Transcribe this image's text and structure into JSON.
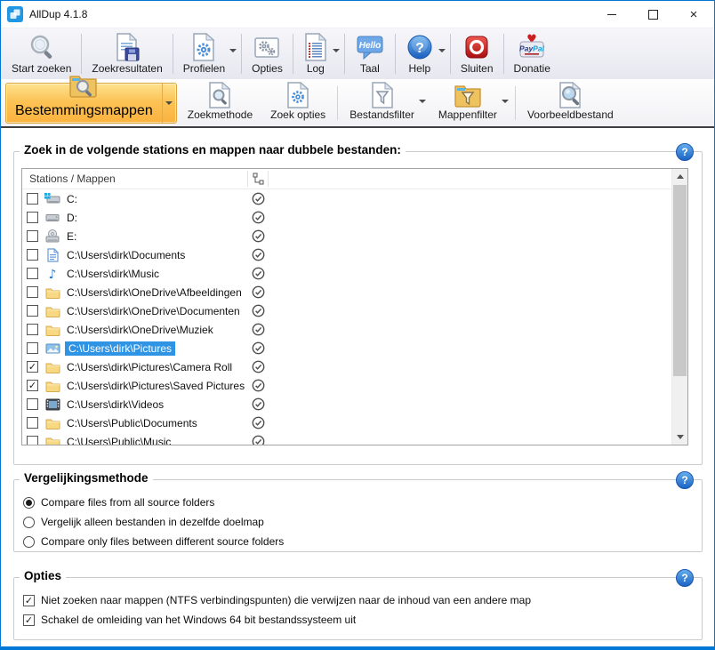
{
  "titlebar": {
    "title": "AllDup 4.1.8"
  },
  "window_controls": {
    "minimize": "minimize",
    "maximize": "maximize",
    "close": "close"
  },
  "toolbar_main": {
    "buttons": [
      {
        "label": "Start zoeken",
        "icon": "search-icon",
        "dropdown": false
      },
      {
        "label": "Zoekresultaten",
        "icon": "search-results-icon",
        "dropdown": false
      },
      {
        "label": "Profielen",
        "icon": "profiles-icon",
        "dropdown": true
      },
      {
        "label": "Opties",
        "icon": "options-icon",
        "dropdown": false
      },
      {
        "label": "Log",
        "icon": "log-icon",
        "dropdown": true
      },
      {
        "label": "Taal",
        "icon": "language-icon",
        "dropdown": false
      },
      {
        "label": "Help",
        "icon": "help-icon",
        "dropdown": true
      },
      {
        "label": "Sluiten",
        "icon": "close-app-icon",
        "dropdown": false
      },
      {
        "label": "Donatie",
        "icon": "paypal-donate-icon",
        "dropdown": false
      }
    ]
  },
  "toolbar_search": {
    "buttons": [
      {
        "label": "Bestemmingsmappen",
        "icon": "folder-search-icon",
        "dropdown": true,
        "active": true
      },
      {
        "label": "Zoekmethode",
        "icon": "file-search-icon",
        "dropdown": false
      },
      {
        "label": "Zoek opties",
        "icon": "file-gear-icon",
        "dropdown": false
      },
      {
        "label": "Bestandsfilter",
        "icon": "file-filter-icon",
        "dropdown": true,
        "sep_before": true
      },
      {
        "label": "Mappenfilter",
        "icon": "folder-filter-icon",
        "dropdown": true
      },
      {
        "label": "Voorbeeldbestand",
        "icon": "file-preview-icon",
        "dropdown": false,
        "sep_before": true
      }
    ]
  },
  "source_section": {
    "title": "Zoek in de volgende stations en mappen naar dubbele bestanden:",
    "column_header": "Stations / Mappen",
    "rows": [
      {
        "path": "C:",
        "icon": "system-drive",
        "checked": false,
        "selected": false
      },
      {
        "path": "D:",
        "icon": "drive",
        "checked": false,
        "selected": false
      },
      {
        "path": "E:",
        "icon": "cd-drive",
        "checked": false,
        "selected": false
      },
      {
        "path": "C:\\Users\\dirk\\Documents",
        "icon": "documents",
        "checked": false,
        "selected": false
      },
      {
        "path": "C:\\Users\\dirk\\Music",
        "icon": "music",
        "checked": false,
        "selected": false
      },
      {
        "path": "C:\\Users\\dirk\\OneDrive\\Afbeeldingen",
        "icon": "folder",
        "checked": false,
        "selected": false
      },
      {
        "path": "C:\\Users\\dirk\\OneDrive\\Documenten",
        "icon": "folder",
        "checked": false,
        "selected": false
      },
      {
        "path": "C:\\Users\\dirk\\OneDrive\\Muziek",
        "icon": "folder",
        "checked": false,
        "selected": false
      },
      {
        "path": "C:\\Users\\dirk\\Pictures",
        "icon": "pictures",
        "checked": false,
        "selected": true
      },
      {
        "path": "C:\\Users\\dirk\\Pictures\\Camera Roll",
        "icon": "folder",
        "checked": true,
        "selected": false
      },
      {
        "path": "C:\\Users\\dirk\\Pictures\\Saved Pictures",
        "icon": "folder",
        "checked": true,
        "selected": false
      },
      {
        "path": "C:\\Users\\dirk\\Videos",
        "icon": "videos",
        "checked": false,
        "selected": false
      },
      {
        "path": "C:\\Users\\Public\\Documents",
        "icon": "folder",
        "checked": false,
        "selected": false
      },
      {
        "path": "C:\\Users\\Public\\Music",
        "icon": "folder",
        "checked": false,
        "selected": false
      }
    ]
  },
  "compare_section": {
    "title": "Vergelijkingsmethode",
    "options": [
      {
        "label": "Compare files from all source folders",
        "selected": true
      },
      {
        "label": "Vergelijk alleen bestanden in dezelfde doelmap",
        "selected": false
      },
      {
        "label": "Compare only files between different source folders",
        "selected": false
      }
    ]
  },
  "options_section": {
    "title": "Opties",
    "options": [
      {
        "label": "Niet zoeken naar mappen (NTFS verbindingspunten) die verwijzen naar de inhoud van een andere map",
        "checked": true
      },
      {
        "label": "Schakel de omleiding van het Windows 64 bit bestandssysteem uit",
        "checked": true
      }
    ]
  },
  "colors": {
    "accent_border": "#0078d7",
    "active_button": "#fbbf47",
    "selection": "#3094e4",
    "help_icon": "#2f7fd6",
    "toolbar_underline": "#3e3e40"
  }
}
